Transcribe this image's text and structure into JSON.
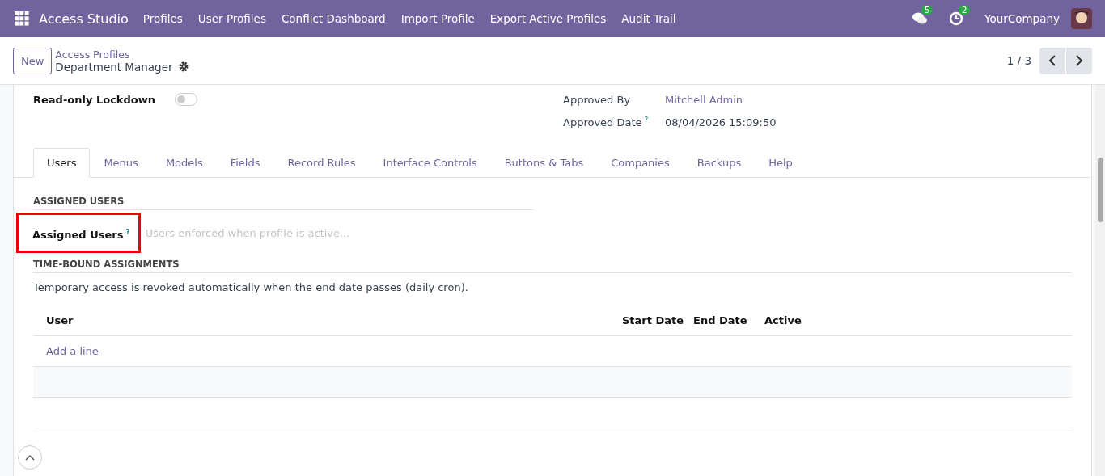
{
  "navbar": {
    "app_name": "Access Studio",
    "menu": [
      "Profiles",
      "User Profiles",
      "Conflict Dashboard",
      "Import Profile",
      "Export Active Profiles",
      "Audit Trail"
    ],
    "messages_badge": "5",
    "activities_badge": "2",
    "company": "YourCompany"
  },
  "control_panel": {
    "new_button": "New",
    "breadcrumb": "Access Profiles",
    "record_title": "Department Manager",
    "pager": "1 / 3"
  },
  "form": {
    "left_fields": [
      {
        "label": "Read-only Lockdown",
        "kind": "toggle",
        "on": false
      }
    ],
    "right_fields": [
      {
        "label": "Approved By",
        "value": "Mitchell Admin",
        "kind": "link"
      },
      {
        "label": "Approved Date",
        "value": "08/04/2026 15:09:50",
        "help_mark": "?",
        "kind": "text"
      }
    ],
    "tabs": [
      {
        "label": "Users",
        "selected": true
      },
      {
        "label": "Menus",
        "selected": false
      },
      {
        "label": "Models",
        "selected": false
      },
      {
        "label": "Fields",
        "selected": false
      },
      {
        "label": "Record Rules",
        "selected": false
      },
      {
        "label": "Interface Controls",
        "selected": false
      },
      {
        "label": "Buttons & Tabs",
        "selected": false
      },
      {
        "label": "Companies",
        "selected": false
      },
      {
        "label": "Backups",
        "selected": false
      },
      {
        "label": "Help",
        "selected": false
      }
    ],
    "assigned_section": {
      "title": "ASSIGNED USERS",
      "field_label": "Assigned Users",
      "help_mark": "?",
      "placeholder": "Users enforced when profile is active..."
    },
    "time_bound_section": {
      "title": "TIME-BOUND ASSIGNMENTS",
      "note": "Temporary access is revoked automatically when the end date passes (daily cron).",
      "columns": [
        "User",
        "Start Date",
        "End Date",
        "Active"
      ],
      "add_line": "Add a line"
    }
  }
}
